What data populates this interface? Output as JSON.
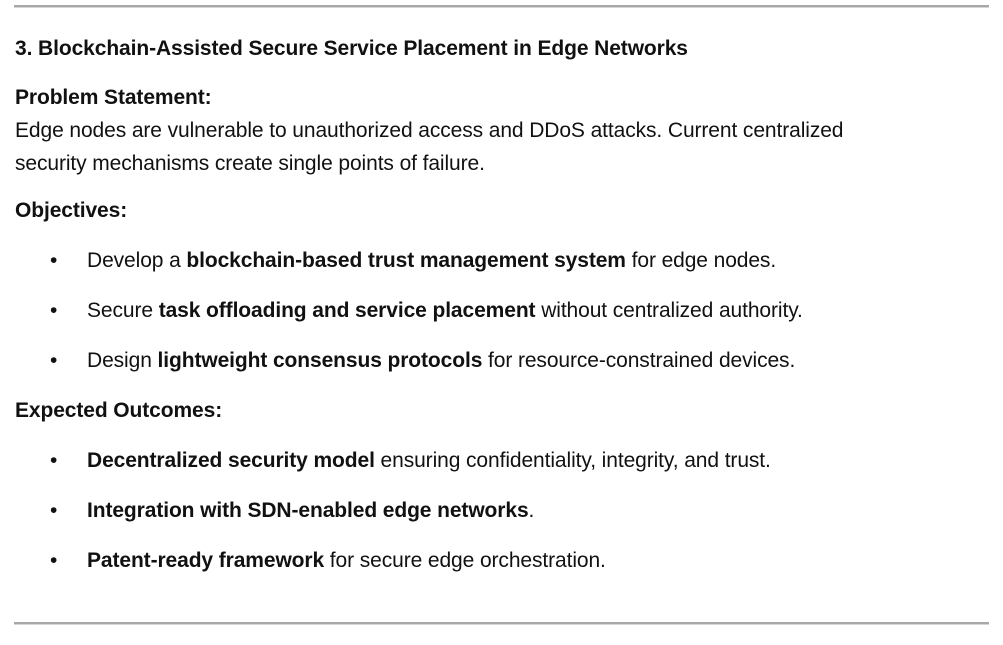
{
  "section": {
    "title": "3. Blockchain-Assisted Secure Service Placement in Edge Networks",
    "problem_heading": "Problem Statement:",
    "problem_line1": "Edge nodes are vulnerable to unauthorized access and DDoS attacks. Current centralized",
    "problem_line2": "security mechanisms create single points of failure.",
    "objectives_heading": "Objectives:",
    "objectives": [
      {
        "pre": "Develop a ",
        "bold": "blockchain-based trust management system",
        "post": " for edge nodes."
      },
      {
        "pre": "Secure ",
        "bold": "task offloading and service placement",
        "post": " without centralized authority."
      },
      {
        "pre": "Design ",
        "bold": "lightweight consensus protocols",
        "post": " for resource-constrained devices."
      }
    ],
    "outcomes_heading": "Expected Outcomes:",
    "outcomes": [
      {
        "pre": "",
        "bold": "Decentralized security model",
        "post": " ensuring confidentiality, integrity, and trust."
      },
      {
        "pre": "",
        "bold": "Integration with SDN-enabled edge networks",
        "post": "."
      },
      {
        "pre": "",
        "bold": "Patent-ready framework",
        "post": " for secure edge orchestration."
      }
    ],
    "bullet_glyph": "•"
  }
}
